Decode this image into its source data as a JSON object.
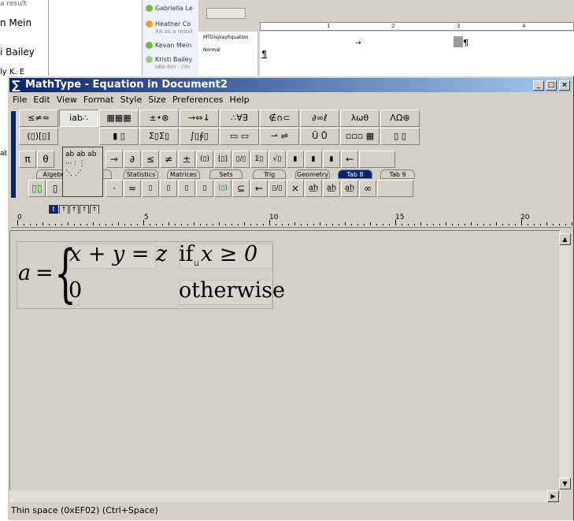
{
  "background": {
    "left_names": [
      "a result",
      "n Mein",
      "i Bailey",
      "ly K. E",
      "",
      "",
      "ab"
    ],
    "contacts": [
      {
        "name": "Gabriella Le",
        "sub": "",
        "color": "#6fbf3a"
      },
      {
        "name": "Heather Co",
        "sub": "XA as a result",
        "color": "#e6a817"
      },
      {
        "name": "Kevan Mein",
        "sub": "",
        "color": "#6fbf3a"
      },
      {
        "name": "Kristi Bailey",
        "sub": "Idle 6m - I'm",
        "color": "#9ec88a"
      }
    ],
    "word": {
      "style1": "MTDisplayEquation",
      "style2": "Normal",
      "ruler_nums": [
        "1",
        "2",
        "3",
        "4"
      ],
      "para_mark": "¶",
      "arrow": "→"
    }
  },
  "window": {
    "title": "MathType - Equation in Document2",
    "controls": {
      "minimize": "_",
      "maximize": "□",
      "close": "×"
    }
  },
  "menu": [
    "File",
    "Edit",
    "View",
    "Format",
    "Style",
    "Size",
    "Preferences",
    "Help"
  ],
  "palette": {
    "row1": [
      "≤≠≈",
      "ı̇ab∴",
      "▦▦▦",
      "±•⊗",
      "→⇔↓",
      "∴∀∃",
      "∉∩⊂",
      "∂∞ℓ",
      "λωθ",
      "ΛΩ⊛"
    ],
    "row2": [
      "(▯)[▯]",
      "",
      "▮ ▯",
      "Σ▯Σ▯",
      "∫▯∮▯",
      "▭ ▭",
      "⇀ ⇌",
      "Ū Ů",
      "▫▫▫ ▦",
      "▯ ▯"
    ],
    "row3": [
      "π",
      "θ",
      "→",
      "∂",
      "≤",
      "≠",
      "±",
      "(▯)",
      "[▯]",
      "▯/▯",
      "Σ▯",
      "√▯",
      "▮",
      "▮",
      "▮",
      "←"
    ],
    "tabs": [
      "Algebra",
      "Derivs",
      "Statistics",
      "Matrices",
      "Sets",
      "Trig",
      "Geometry",
      "Tab 8",
      "Tab 9"
    ],
    "row4": [
      "▯▯",
      "▯",
      "",
      "·",
      "≈",
      "▯",
      "▯",
      "▯",
      "▯",
      "(▯)",
      "⊆",
      "←",
      "▯/▯",
      "×",
      "a͟h",
      "a͟h",
      "a͟h",
      "∞"
    ],
    "dropdown": [
      "ab ab ab",
      "··· ∶ ⋮",
      "⋱ ⋰"
    ],
    "sizes": [
      "t",
      "↑",
      "↑",
      "↑",
      "↑"
    ]
  },
  "ruler": {
    "labels": [
      "0",
      "5",
      "10",
      "15",
      "20"
    ]
  },
  "equation": {
    "lhs": "a",
    "equals": "=",
    "case1_expr": "x + y = z",
    "case1_if": "if",
    "case1_cond": "x ≥ 0",
    "case2_expr": "0",
    "case2_cond": "otherwise"
  },
  "status": "Thin space (0xEF02) (Ctrl+Space)"
}
